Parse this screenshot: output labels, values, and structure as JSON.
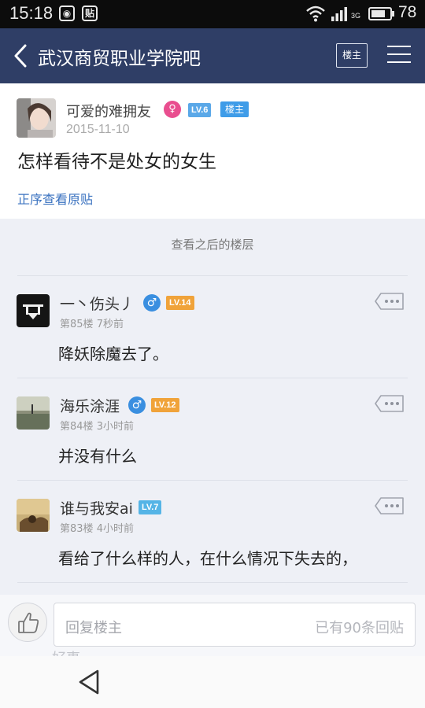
{
  "status_bar": {
    "time": "15:18",
    "notification_icons": [
      "weibo-icon",
      "tieba-icon"
    ],
    "network": "3G",
    "battery_level": "78",
    "battery_fraction": 0.78
  },
  "nav": {
    "title": "武汉商贸职业学院吧",
    "floor_button": "楼主"
  },
  "post": {
    "author": "可爱的难拥友",
    "gender": "♀",
    "level": "LV.6",
    "tag": "楼主",
    "date": "2015-11-10",
    "title": "怎样看待不是处女的女生",
    "view_original": "正序查看原贴"
  },
  "floor_divider": "查看之后的楼层",
  "replies": [
    {
      "name": "一丶伤头丿",
      "gender": "♂",
      "level": "LV.14",
      "level_color": "#f0a33a",
      "floor": "第85楼",
      "time": "7秒前",
      "text": "降妖除魔去了。"
    },
    {
      "name": "海乐涂涯",
      "gender": "♂",
      "level": "LV.12",
      "level_color": "#f0a33a",
      "floor": "第84楼",
      "time": "3小时前",
      "text": "并没有什么"
    },
    {
      "name": "谁与我安ai",
      "gender": "",
      "level": "LV.7",
      "level_color": "#55b4e6",
      "floor": "第83楼",
      "time": "4小时前",
      "text": "看给了什么样的人，在什么情况下失去的，"
    }
  ],
  "ghost_text": "好事",
  "reply_bar": {
    "placeholder": "回复楼主",
    "count": "已有90条回贴"
  },
  "colors": {
    "nav_bg": "#2f3e66",
    "link": "#3a72c0",
    "female": "#e94e8f",
    "male": "#3a8fe0",
    "op_tag": "#3f9ce8"
  }
}
